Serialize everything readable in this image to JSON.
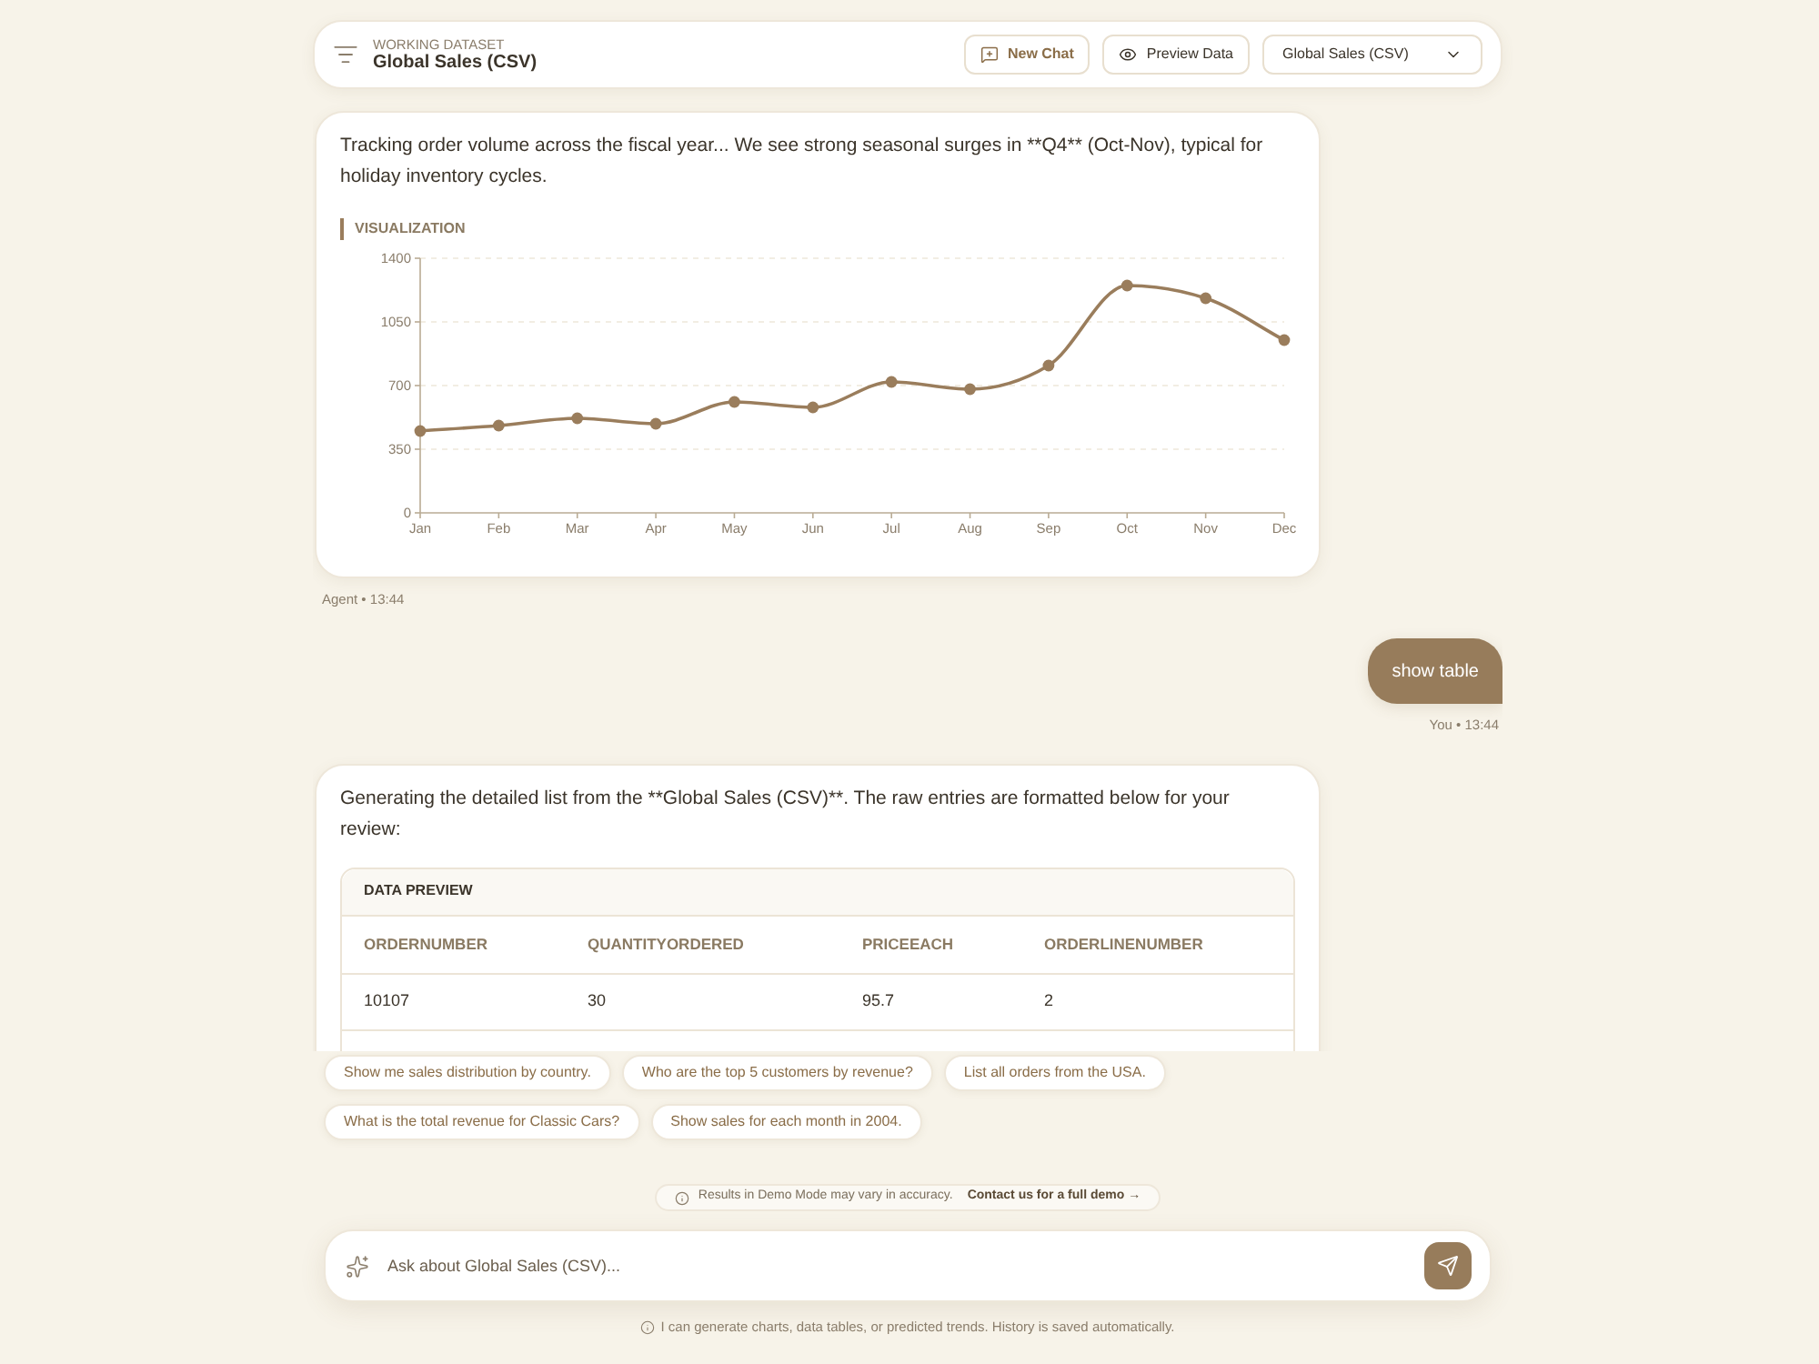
{
  "header": {
    "eyebrow": "WORKING DATASET",
    "title": "Global Sales (CSV)",
    "buttons": [
      {
        "kind": "new-chat",
        "label": "New Chat"
      },
      {
        "kind": "preview",
        "label": "Preview Data"
      }
    ],
    "dataset_select": {
      "value": "Global Sales (CSV)"
    }
  },
  "messages": [
    {
      "kind": "agent",
      "text": "Tracking order volume across the fiscal year... We see strong seasonal surges in **Q4** (Oct-Nov), typical for holiday inventory cycles.",
      "section_label": "VISUALIZATION",
      "chart_data": {
        "type": "line",
        "categories": [
          "Jan",
          "Feb",
          "Mar",
          "Apr",
          "May",
          "Jun",
          "Jul",
          "Aug",
          "Sep",
          "Oct",
          "Nov",
          "Dec"
        ],
        "series": [
          {
            "color": "#9a7d5c",
            "marker": true,
            "values": [
              450,
              480,
              520,
              490,
              610,
              580,
              720,
              680,
              810,
              1250,
              1180,
              950
            ]
          }
        ],
        "ylim": [
          0,
          1400
        ],
        "yticks": [
          0,
          350,
          700,
          1050,
          1400
        ],
        "grid": true
      },
      "meta": "Agent • 13:44"
    },
    {
      "kind": "user",
      "text": "show table",
      "meta": "You • 13:44"
    },
    {
      "kind": "agent",
      "text": "Generating the detailed list from the **Global Sales (CSV)**. The raw entries are formatted below for your review:",
      "table": {
        "title": "DATA PREVIEW",
        "columns": [
          "ORDERNUMBER",
          "QUANTITYORDERED",
          "PRICEEACH",
          "ORDERLINENUMBER"
        ],
        "rows": [
          [
            "10107",
            "30",
            "95.7",
            "2"
          ]
        ]
      }
    }
  ],
  "suggestions": [
    "Show me sales distribution by country.",
    "Who are the top 5 customers by revenue?",
    "List all orders from the USA.",
    "What is the total revenue for Classic Cars?",
    "Show sales for each month in 2004."
  ],
  "notice": {
    "text": "Results in Demo Mode may vary in accuracy.",
    "link": "Contact us for a full demo →"
  },
  "composer": {
    "placeholder": "Ask about Global Sales (CSV)..."
  },
  "footer_hint": "I can generate charts, data tables, or predicted trends. History is saved automatically."
}
